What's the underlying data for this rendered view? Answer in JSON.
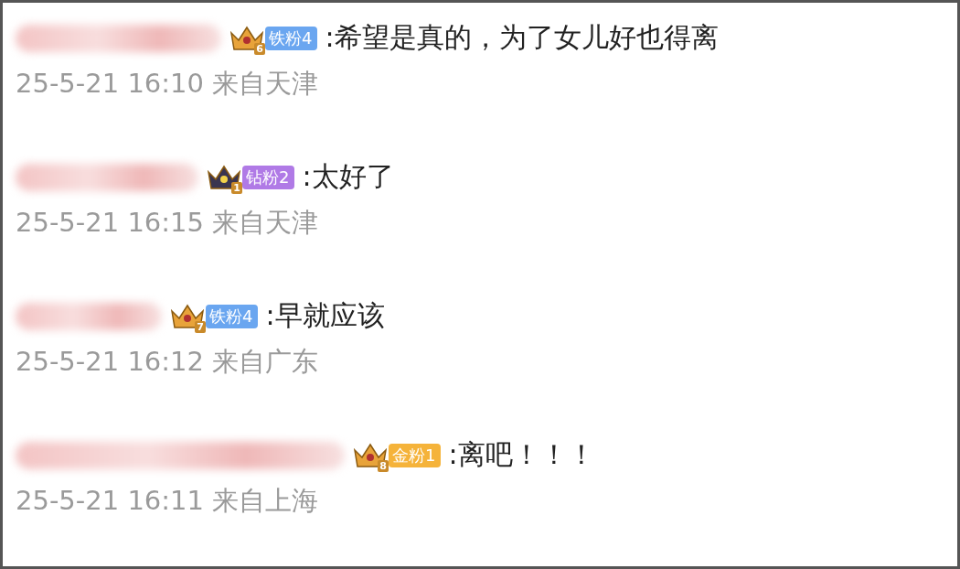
{
  "comments": [
    {
      "crown": {
        "kind": "gold",
        "level": "6"
      },
      "badge": {
        "label": "铁粉4",
        "color": "#6aa6f0"
      },
      "text": ":希望是真的，为了女儿好也得离",
      "time": "25-5-21 16:10 来自天津"
    },
    {
      "crown": {
        "kind": "dark",
        "level": "1"
      },
      "badge": {
        "label": "钻粉2",
        "color": "#b07ae6"
      },
      "text": ":太好了",
      "time": "25-5-21 16:15 来自天津"
    },
    {
      "crown": {
        "kind": "gold",
        "level": "7"
      },
      "badge": {
        "label": "铁粉4",
        "color": "#6aa6f0"
      },
      "text": ":早就应该",
      "time": "25-5-21 16:12 来自广东"
    },
    {
      "crown": {
        "kind": "gold",
        "level": "8"
      },
      "badge": {
        "label": "金粉1",
        "color": "#f5b33a"
      },
      "text": ":离吧！！！",
      "time": "25-5-21 16:11 来自上海"
    }
  ]
}
